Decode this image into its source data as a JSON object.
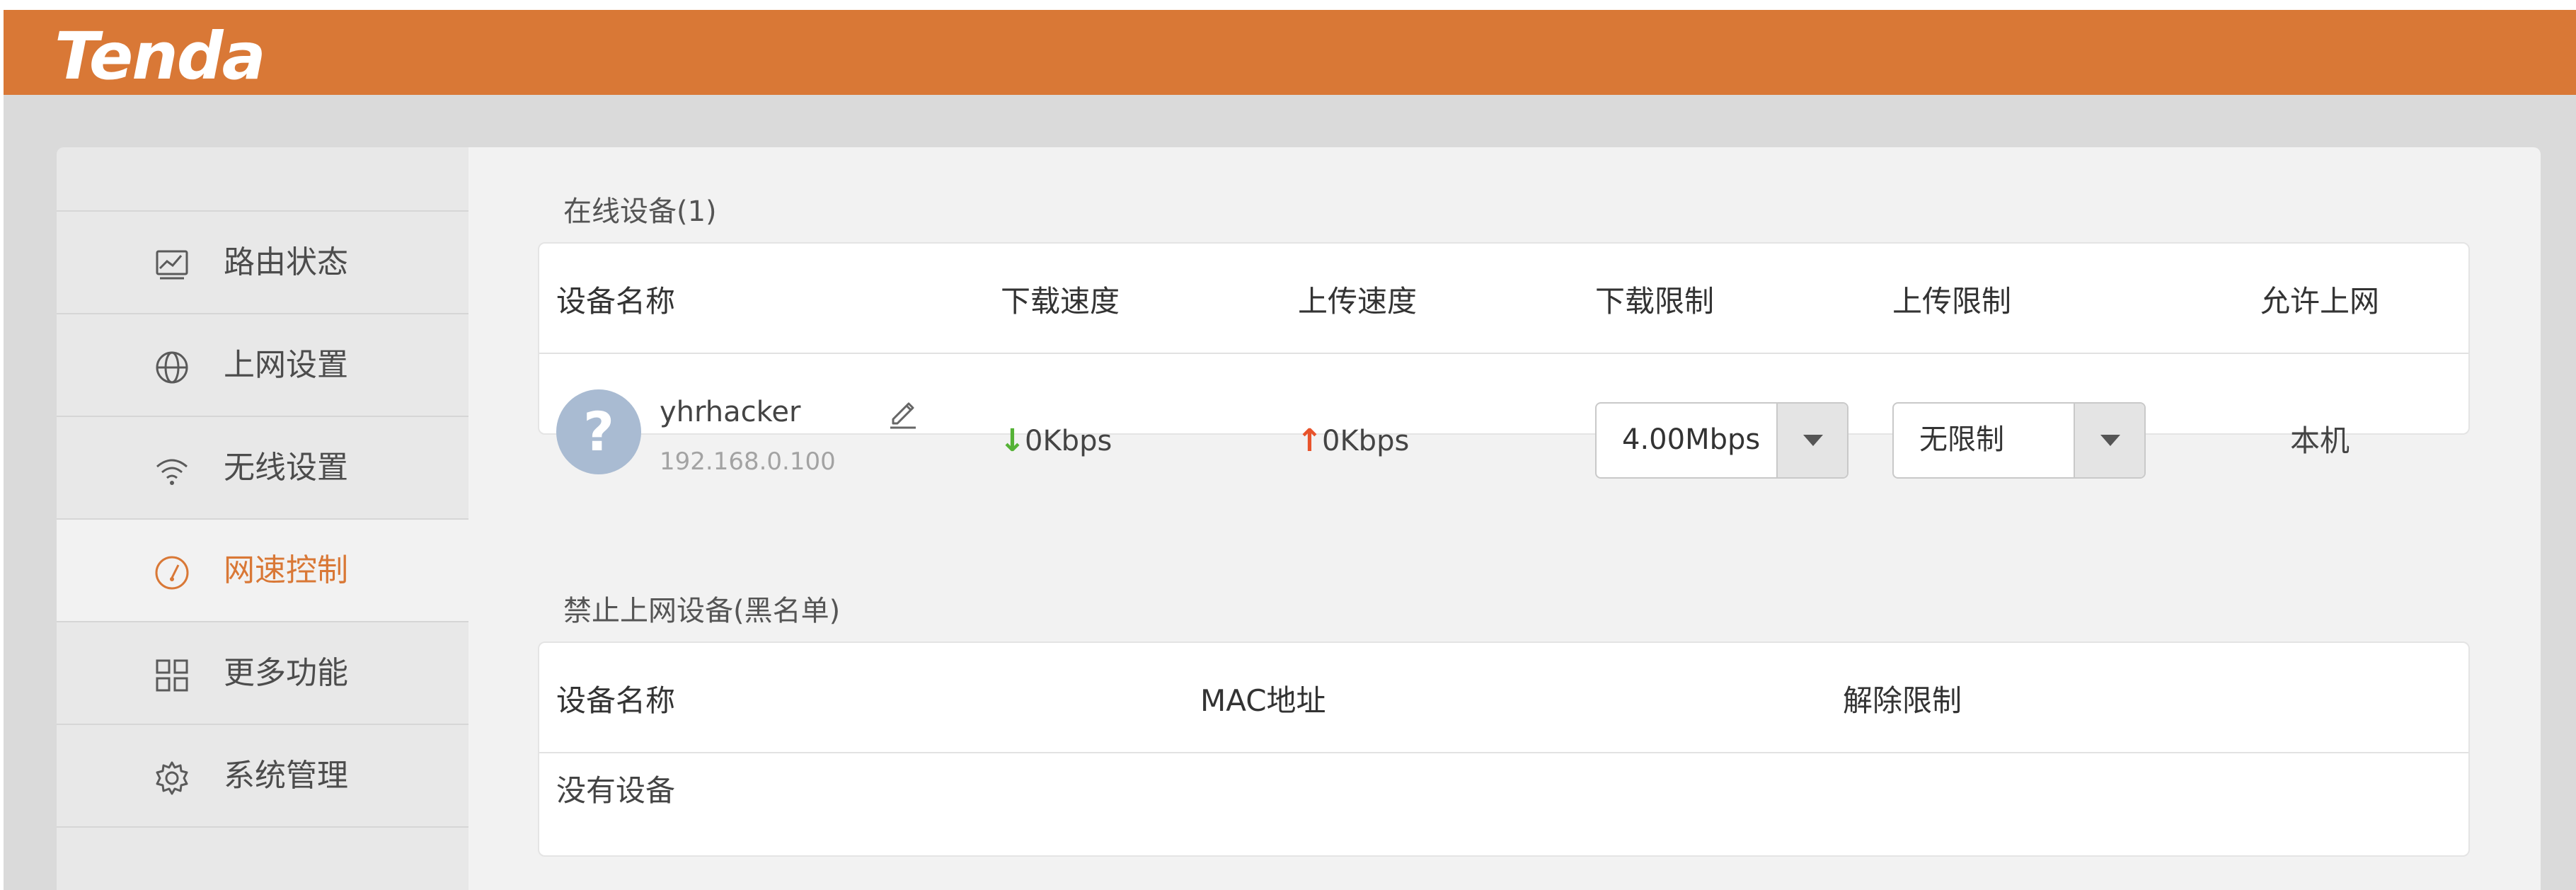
{
  "header": {
    "logo": "Tenda",
    "brand_color": "#d97836"
  },
  "sidebar": {
    "items": [
      {
        "label": "路由状态",
        "icon": "chart-icon",
        "active": false
      },
      {
        "label": "上网设置",
        "icon": "globe-icon",
        "active": false
      },
      {
        "label": "无线设置",
        "icon": "wifi-icon",
        "active": false
      },
      {
        "label": "网速控制",
        "icon": "speedometer-icon",
        "active": true
      },
      {
        "label": "更多功能",
        "icon": "grid-icon",
        "active": false
      },
      {
        "label": "系统管理",
        "icon": "gear-icon",
        "active": false
      }
    ]
  },
  "online": {
    "title": "在线设备(1)",
    "columns": [
      "设备名称",
      "下载速度",
      "上传速度",
      "下载限制",
      "上传限制",
      "允许上网"
    ],
    "devices": [
      {
        "name": "yhrhacker",
        "ip": "192.168.0.100",
        "download_speed": "0Kbps",
        "upload_speed": "0Kbps",
        "download_limit": "4.00Mbps",
        "upload_limit": "无限制",
        "allow": "本机",
        "down_arrow": "↓",
        "up_arrow": "↑",
        "avatar_glyph": "?"
      }
    ]
  },
  "blacklist": {
    "title": "禁止上网设备(黑名单)",
    "columns": [
      "设备名称",
      "MAC地址",
      "解除限制"
    ],
    "empty_text": "没有设备"
  }
}
